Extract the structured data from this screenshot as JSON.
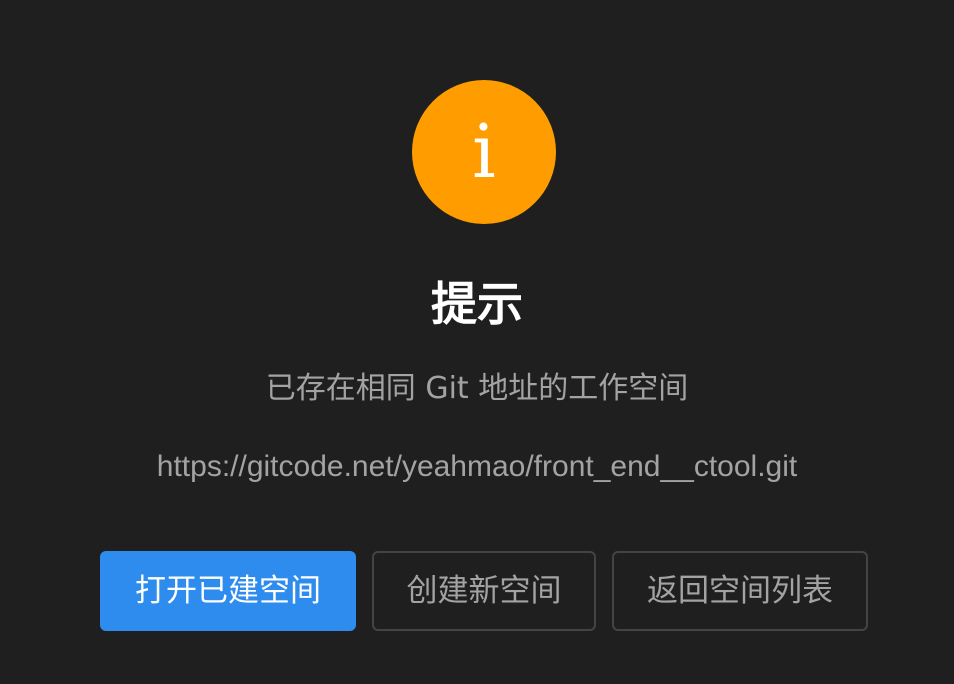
{
  "dialog": {
    "icon": {
      "name": "info-icon",
      "glyph": "i",
      "color": "#ff9c00"
    },
    "title": "提示",
    "message": "已存在相同 Git 地址的工作空间",
    "url": "https://gitcode.net/yeahmao/front_end__ctool.git",
    "buttons": {
      "open_label": "打开已建空间",
      "create_label": "创建新空间",
      "back_label": "返回空间列表"
    },
    "colors": {
      "background": "#1f1f1f",
      "primary": "#2e8cee",
      "text_muted": "#a3a3a3",
      "border": "#444444"
    }
  }
}
